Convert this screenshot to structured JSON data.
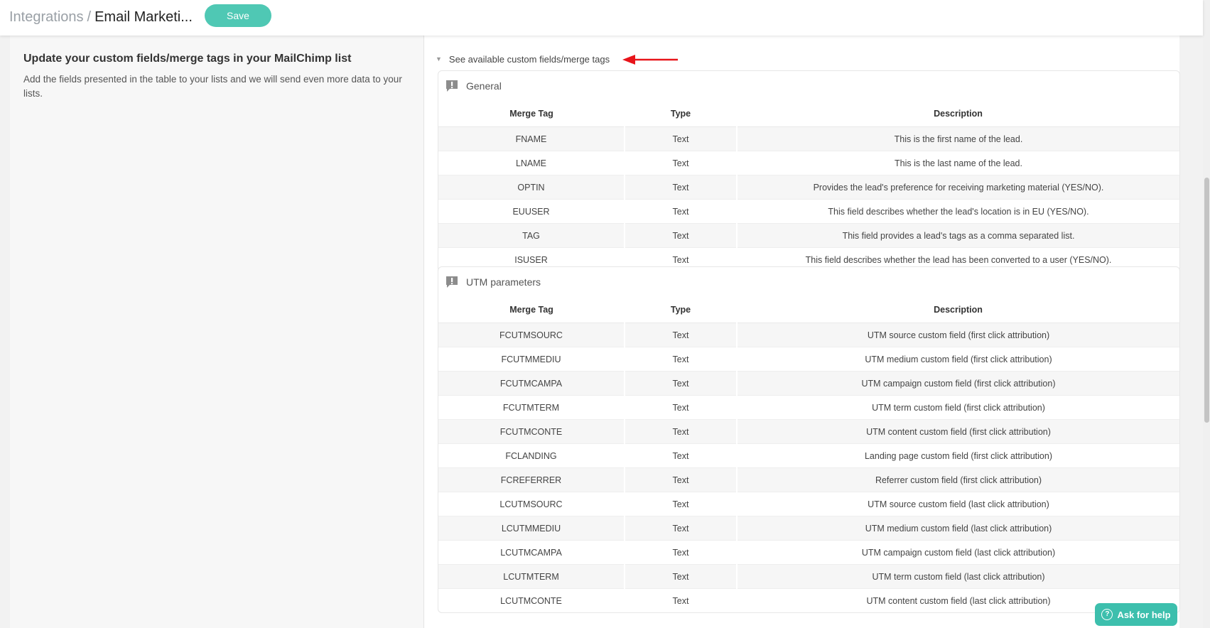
{
  "header": {
    "breadcrumb_parent": "Integrations",
    "breadcrumb_separator": "/",
    "breadcrumb_current": "Email Marketi...",
    "save_label": "Save",
    "accent_color": "#4fc8b4"
  },
  "left": {
    "title": "Update your custom fields/merge tags in your MailChimp list",
    "description": "Add the fields presented in the table to your lists and we will send even more data to your lists."
  },
  "toggle": {
    "icon": "caret-down-icon",
    "label": "See available custom fields/merge tags",
    "annotation_color": "#e8141a"
  },
  "columns": {
    "merge_tag": "Merge Tag",
    "type": "Type",
    "description": "Description"
  },
  "general": {
    "icon": "exclamation-chat-icon",
    "title": "General",
    "rows": [
      {
        "tag": "FNAME",
        "type": "Text",
        "desc": "This is the first name of the lead."
      },
      {
        "tag": "LNAME",
        "type": "Text",
        "desc": "This is the last name of the lead."
      },
      {
        "tag": "OPTIN",
        "type": "Text",
        "desc": "Provides the lead's preference for receiving marketing material (YES/NO)."
      },
      {
        "tag": "EUUSER",
        "type": "Text",
        "desc": "This field describes whether the lead's location is in EU (YES/NO)."
      },
      {
        "tag": "TAG",
        "type": "Text",
        "desc": "This field provides a lead's tags as a comma separated list."
      },
      {
        "tag": "ISUSER",
        "type": "Text",
        "desc": "This field describes whether the lead has been converted to a user (YES/NO)."
      }
    ]
  },
  "utm": {
    "icon": "exclamation-chat-icon",
    "title": "UTM parameters",
    "rows": [
      {
        "tag": "FCUTMSOURC",
        "type": "Text",
        "desc": "UTM source custom field (first click attribution)"
      },
      {
        "tag": "FCUTMMEDIU",
        "type": "Text",
        "desc": "UTM medium custom field (first click attribution)"
      },
      {
        "tag": "FCUTMCAMPA",
        "type": "Text",
        "desc": "UTM campaign custom field (first click attribution)"
      },
      {
        "tag": "FCUTMTERM",
        "type": "Text",
        "desc": "UTM term custom field (first click attribution)"
      },
      {
        "tag": "FCUTMCONTE",
        "type": "Text",
        "desc": "UTM content custom field (first click attribution)"
      },
      {
        "tag": "FCLANDING",
        "type": "Text",
        "desc": "Landing page custom field (first click attribution)"
      },
      {
        "tag": "FCREFERRER",
        "type": "Text",
        "desc": "Referrer custom field (first click attribution)"
      },
      {
        "tag": "LCUTMSOURC",
        "type": "Text",
        "desc": "UTM source custom field (last click attribution)"
      },
      {
        "tag": "LCUTMMEDIU",
        "type": "Text",
        "desc": "UTM medium custom field (last click attribution)"
      },
      {
        "tag": "LCUTMCAMPA",
        "type": "Text",
        "desc": "UTM campaign custom field (last click attribution)"
      },
      {
        "tag": "LCUTMTERM",
        "type": "Text",
        "desc": "UTM term custom field (last click attribution)"
      },
      {
        "tag": "LCUTMCONTE",
        "type": "Text",
        "desc": "UTM content custom field (last click attribution)"
      }
    ]
  },
  "help": {
    "icon": "question-circle-icon",
    "label": "Ask for help"
  }
}
